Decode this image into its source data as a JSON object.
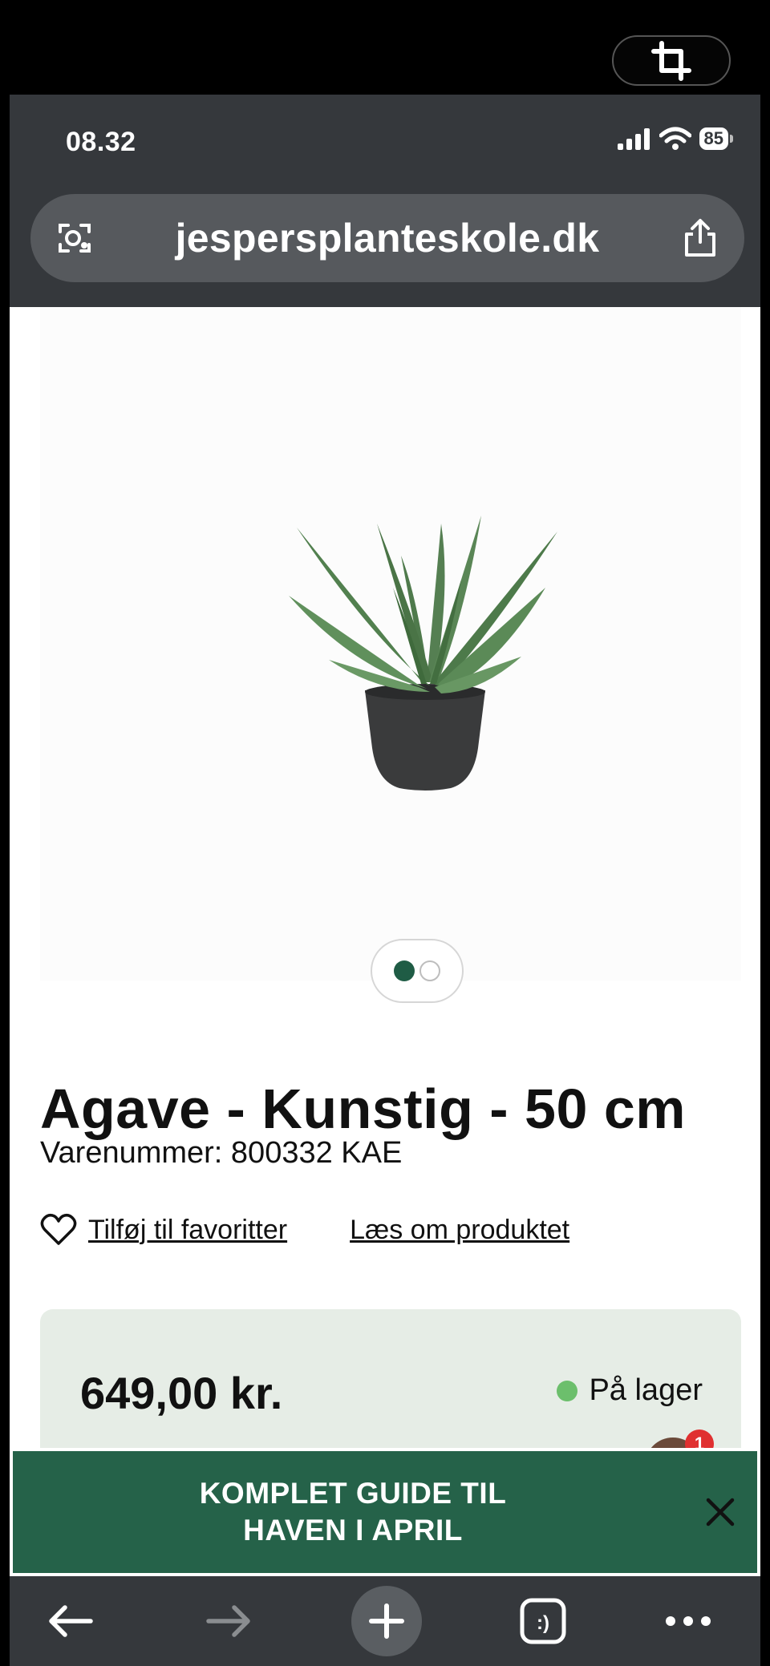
{
  "status_bar": {
    "time": "08.32",
    "battery": "85"
  },
  "browser": {
    "url": "jespersplanteskole.dk"
  },
  "product": {
    "title": "Agave - Kunstig - 50 cm",
    "sku": "Varenummer: 800332 KAE",
    "favorite_label": "Tilføj til favoritter",
    "read_more_label": "Læs om produktet",
    "price": "649,00 kr.",
    "stock": "På lager",
    "image_count": 2,
    "image_index": 1
  },
  "chat": {
    "badge": "1"
  },
  "banner": {
    "line1": "KOMPLET GUIDE TIL",
    "line2": "HAVEN I APRIL"
  },
  "colors": {
    "brand_green": "#256249",
    "stock_green": "#6cbf6c",
    "chrome": "#35383c"
  }
}
